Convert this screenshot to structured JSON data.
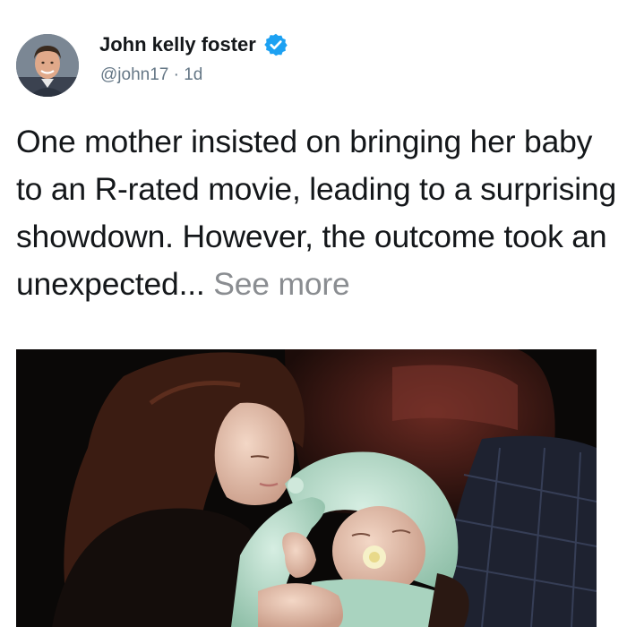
{
  "post": {
    "author": {
      "name": "John kelly foster",
      "handle": "@john17",
      "separator": " · ",
      "time": "1d",
      "verified": true,
      "avatar_icon": "profile-photo"
    },
    "text": "One mother insisted on bringing her baby to an R-rated movie, leading to a surprising showdown. However, the outcome took an unexpected...",
    "see_more_label": " See more",
    "image_icon": "photo-mother-holding-baby-in-theater"
  },
  "colors": {
    "verified_badge": "#1da1f2",
    "secondary_text": "#657786",
    "see_more": "#8a8d91"
  }
}
